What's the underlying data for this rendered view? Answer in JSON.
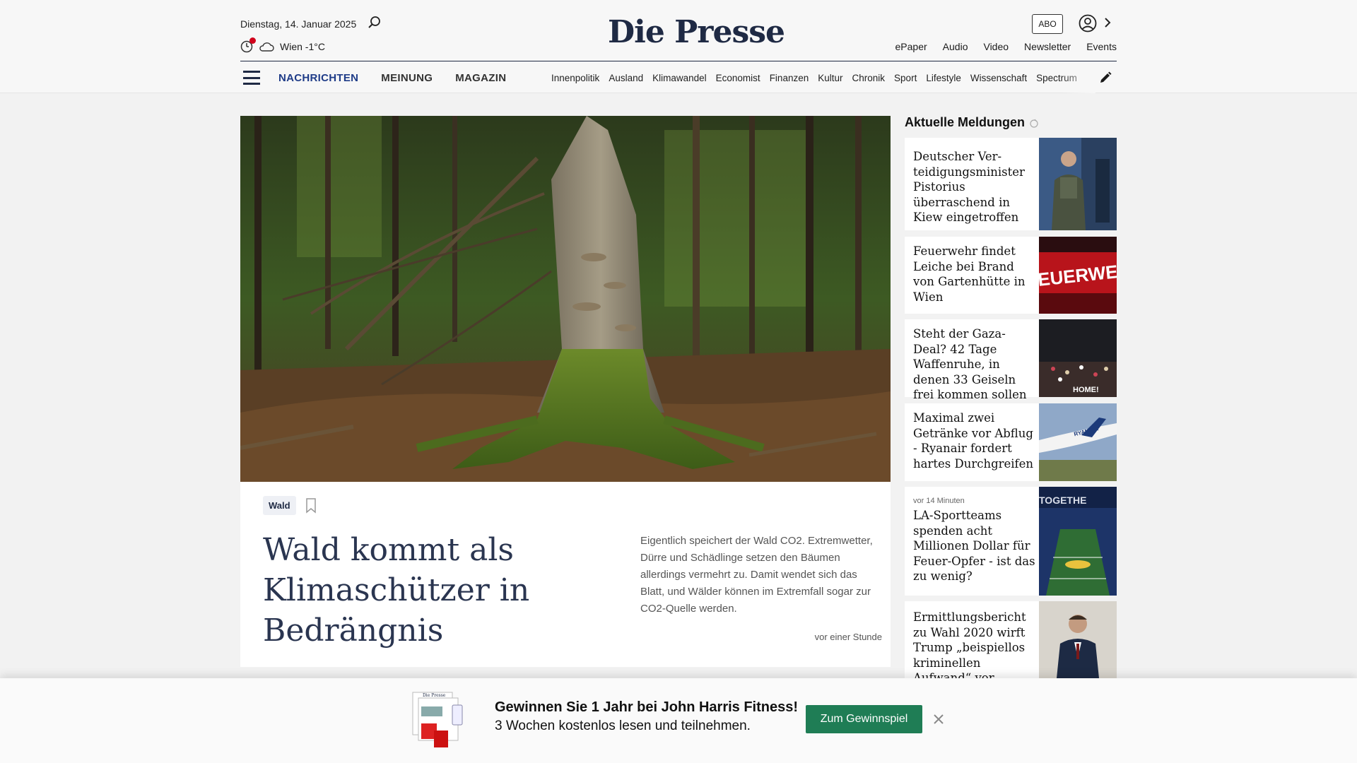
{
  "header": {
    "date": "Dienstag, 14. Januar 2025",
    "weather": "Wien -1°C",
    "logo": "Die Presse",
    "abo_label": "ABO",
    "top_links": [
      "ePaper",
      "Audio",
      "Video",
      "Newsletter",
      "Events"
    ]
  },
  "nav": {
    "main": [
      "NACHRICHTEN",
      "MEINUNG",
      "MAGAZIN"
    ],
    "sections": [
      "Innenpolitik",
      "Ausland",
      "Klimawandel",
      "Economist",
      "Finanzen",
      "Kultur",
      "Chronik",
      "Sport",
      "Lifestyle",
      "Wissenschaft",
      "Spectrum"
    ]
  },
  "hero": {
    "tag": "Wald",
    "title": "Wald kommt als Klima­schützer in Bedrängnis",
    "teaser": "Eigentlich speichert der Wald CO2. Extremwetter, Dürre und Schädlinge setzen den Bäumen allerdings vermehrt zu. Damit wendet sich das Blatt, und Wälder können im Extremfall sogar zur CO2-Quelle werden.",
    "time": "vor einer Stunde"
  },
  "sidebar": {
    "title": "Aktuelle Meldungen",
    "items": [
      {
        "meta": "",
        "title": "Deutscher Ver­teidigungsminister Pistorius überraschend in Kiew eingetroffen"
      },
      {
        "meta": "",
        "title": "Feuerwehr findet Leiche bei Brand von Gartenhütte in Wien"
      },
      {
        "meta": "",
        "title": "Steht der Gaza-Deal? 42 Tage Waffenruhe, in denen 33 Geiseln frei kommen sollen"
      },
      {
        "meta": "",
        "title": "Maximal zwei Getränke vor Abflug - Ryanair fordert hartes Durchgreifen"
      },
      {
        "meta": "vor 14 Minuten",
        "title": "LA-Sportteams spenden acht Millionen Dollar für Feuer-Opfer - ist das zu wenig?"
      },
      {
        "meta": "",
        "title": "Ermittlungsbericht zu Wahl 2020 wirft Trump „beispiellos kriminellen Aufwand“ vor"
      }
    ],
    "thumb_texts": [
      "EUERWEH",
      "RYANAIR",
      "TOGETHE",
      "HOME!"
    ]
  },
  "banner": {
    "headline": "Gewinnen Sie 1 Jahr bei John Harris Fitness!",
    "subline": "3 Wochen kostenlos lesen und teilnehmen.",
    "button": "Zum Gewinnspiel",
    "product_logo": "Die Presse"
  }
}
